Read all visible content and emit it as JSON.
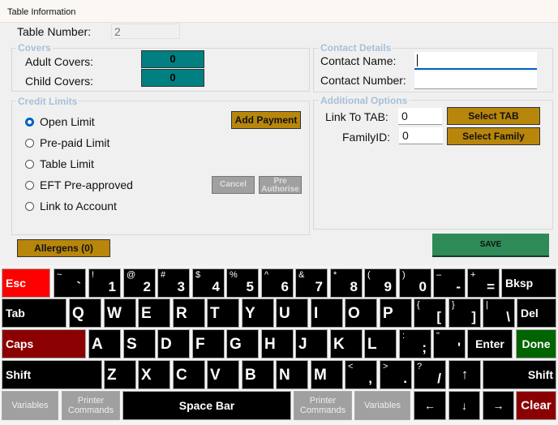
{
  "window": {
    "title": "Table Information"
  },
  "table": {
    "label": "Table Number:",
    "value": "2"
  },
  "covers": {
    "legend": "Covers",
    "adult_label": "Adult Covers:",
    "adult_value": "0",
    "child_label": "Child Covers:",
    "child_value": "0"
  },
  "credit": {
    "legend": "Credit Limits",
    "options": [
      "Open Limit",
      "Pre-paid Limit",
      "Table Limit",
      "EFT Pre-approved",
      "Link to Account"
    ],
    "selected": "Open Limit",
    "add_payment": "Add Payment",
    "cancel": "Cancel",
    "pre_authorise": "Pre Authorise"
  },
  "allergens": "Allergens (0)",
  "contact": {
    "legend": "Contact Details",
    "name_label": "Contact Name:",
    "name_value": "",
    "number_label": "Contact Number:",
    "number_value": ""
  },
  "additional": {
    "legend": "Additional Options",
    "tab_label": "Link To TAB:",
    "tab_value": "0",
    "select_tab": "Select TAB",
    "family_label": "FamilyID:",
    "family_value": "0",
    "select_family": "Select Family"
  },
  "save": "SAVE",
  "keyboard": {
    "rows": [
      [
        [
          "Esc",
          ""
        ],
        [
          "`",
          "~"
        ],
        [
          "1",
          "!"
        ],
        [
          "2",
          "@"
        ],
        [
          "3",
          "#"
        ],
        [
          "4",
          "$"
        ],
        [
          "5",
          "%"
        ],
        [
          "6",
          "^"
        ],
        [
          "7",
          "&"
        ],
        [
          "8",
          "*"
        ],
        [
          "9",
          "("
        ],
        [
          "0",
          ")"
        ],
        [
          "-",
          "–"
        ],
        [
          "=",
          "+"
        ],
        [
          "Bksp",
          ""
        ]
      ],
      [
        [
          "Tab",
          ""
        ],
        [
          "Q",
          ""
        ],
        [
          "W",
          ""
        ],
        [
          "E",
          ""
        ],
        [
          "R",
          ""
        ],
        [
          "T",
          ""
        ],
        [
          "Y",
          ""
        ],
        [
          "U",
          ""
        ],
        [
          "I",
          ""
        ],
        [
          "O",
          ""
        ],
        [
          "P",
          ""
        ],
        [
          "[",
          "{"
        ],
        [
          "]",
          "}"
        ],
        [
          "\\",
          "|"
        ],
        [
          "Del",
          ""
        ]
      ],
      [
        [
          "Caps",
          ""
        ],
        [
          "A",
          ""
        ],
        [
          "S",
          ""
        ],
        [
          "D",
          ""
        ],
        [
          "F",
          ""
        ],
        [
          "G",
          ""
        ],
        [
          "H",
          ""
        ],
        [
          "J",
          ""
        ],
        [
          "K",
          ""
        ],
        [
          "L",
          ""
        ],
        [
          ";",
          ":"
        ],
        [
          "'",
          "\""
        ],
        [
          "Enter",
          ""
        ],
        [
          "Done",
          ""
        ]
      ],
      [
        [
          "Shift",
          ""
        ],
        [
          "Z",
          ""
        ],
        [
          "X",
          ""
        ],
        [
          "C",
          ""
        ],
        [
          "V",
          ""
        ],
        [
          "B",
          ""
        ],
        [
          "N",
          ""
        ],
        [
          "M",
          ""
        ],
        [
          ",",
          "<"
        ],
        [
          ".",
          ">"
        ],
        [
          "/",
          "?"
        ],
        [
          "↑",
          ""
        ],
        [
          "Shift",
          ""
        ]
      ],
      [
        [
          "Variables",
          ""
        ],
        [
          "Printer Commands",
          ""
        ],
        [
          "Space Bar",
          ""
        ],
        [
          "Printer Commands",
          ""
        ],
        [
          "Variables",
          ""
        ],
        [
          "←",
          ""
        ],
        [
          "↓",
          ""
        ],
        [
          "→",
          ""
        ],
        [
          "Clear",
          ""
        ]
      ]
    ]
  },
  "colors": {
    "esc": "#ff0000",
    "caps": "#8b0000",
    "done": "#006400",
    "clear": "#8b0000",
    "grey": "#a0a0a0",
    "save": "#2e8b57",
    "gold": "#b8860b",
    "teal": "#008080"
  }
}
